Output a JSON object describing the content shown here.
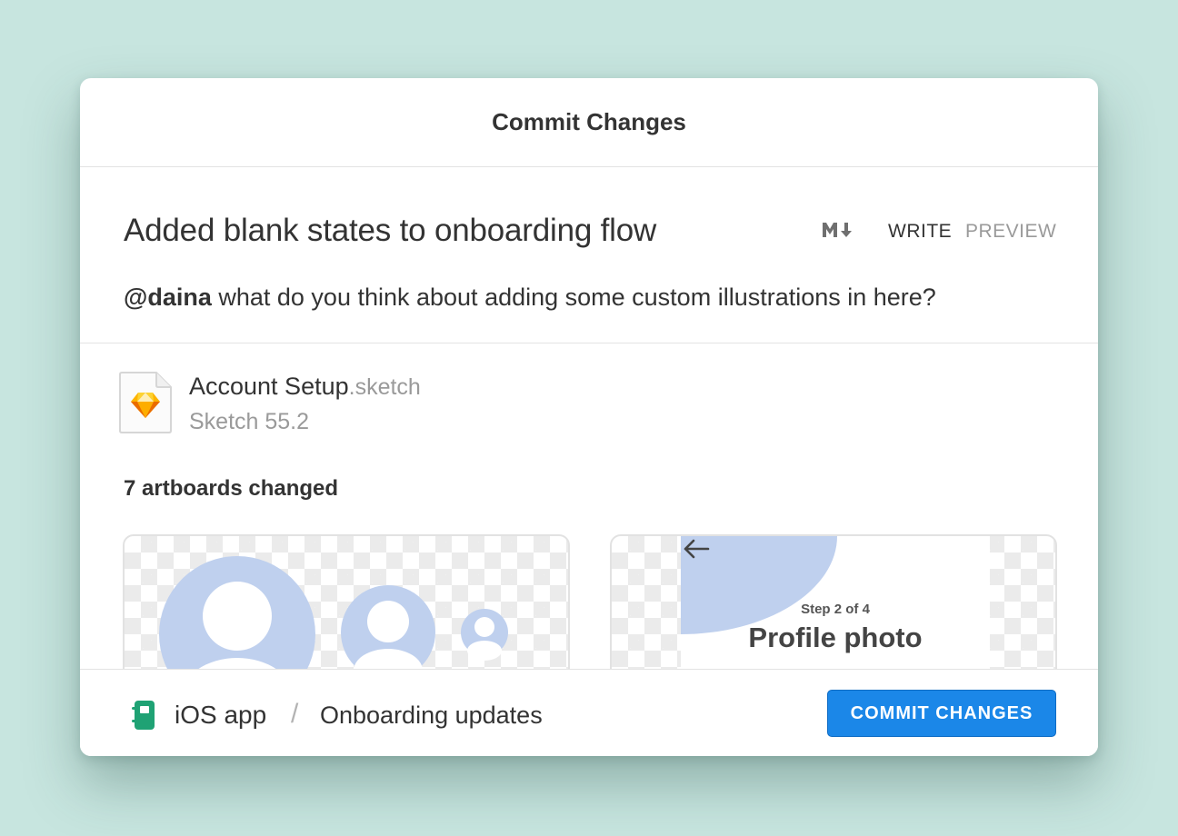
{
  "dialog": {
    "title": "Commit Changes"
  },
  "message": {
    "title": "Added blank states to onboarding flow",
    "markdown_icon": "markdown-icon",
    "tabs": [
      {
        "label": "WRITE",
        "active": true
      },
      {
        "label": "PREVIEW",
        "active": false
      }
    ],
    "body_mention": "@daina",
    "body_text": " what do you think about adding some custom illustrations in here?"
  },
  "file": {
    "icon": "sketch-file-icon",
    "name": "Account Setup",
    "extension": ".sketch",
    "version": "Sketch 55.2"
  },
  "artboards": {
    "changed_label": "7 artboards changed",
    "preview_2": {
      "step": "Step 2 of 4",
      "heading": "Profile photo",
      "back_icon": "back-arrow-icon"
    }
  },
  "footer": {
    "repo_icon": "notebook-icon",
    "repo_name": "iOS app",
    "separator": "/",
    "branch_name": "Onboarding updates",
    "commit_button": "COMMIT CHANGES"
  },
  "colors": {
    "background": "#c7e5df",
    "accent": "#1b87e8",
    "avatar_blue": "#bfd0ee",
    "repo_green": "#1fa274",
    "sketch_orange": "#f7a823"
  }
}
